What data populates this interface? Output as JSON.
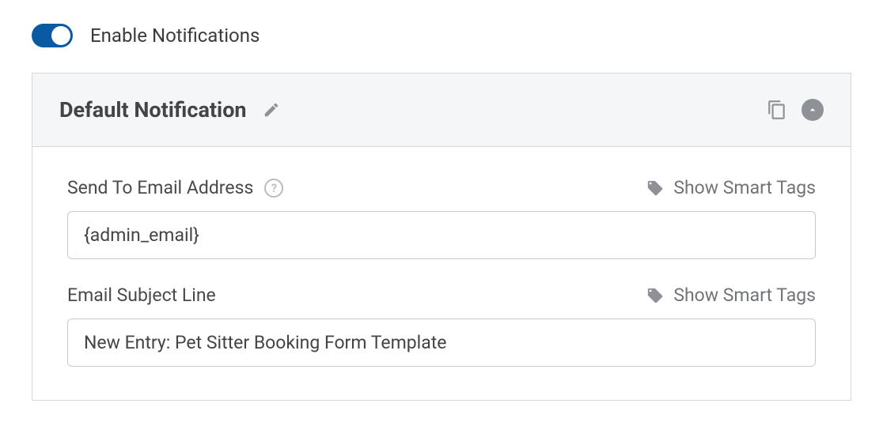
{
  "enable": {
    "label": "Enable Notifications",
    "on": true
  },
  "panel": {
    "title": "Default Notification"
  },
  "fields": {
    "sendTo": {
      "label": "Send To Email Address",
      "smartTags": "Show Smart Tags",
      "value": "{admin_email}"
    },
    "subject": {
      "label": "Email Subject Line",
      "smartTags": "Show Smart Tags",
      "value": "New Entry: Pet Sitter Booking Form Template"
    }
  }
}
